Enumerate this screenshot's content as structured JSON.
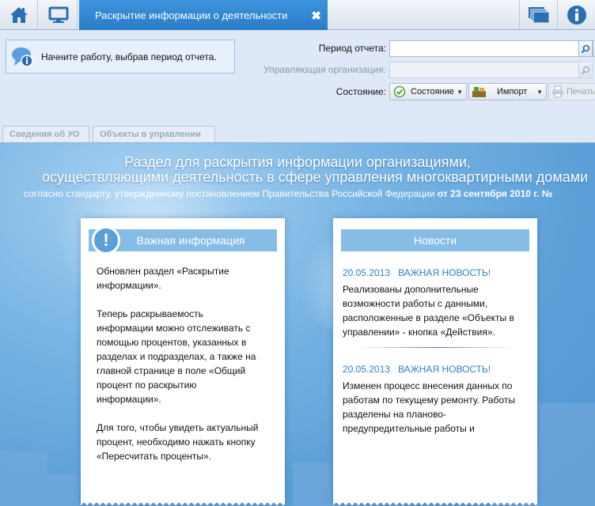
{
  "topbar": {
    "home_icon": "home-icon",
    "monitor_icon": "monitor-icon",
    "tab_title": "Раскрытие информации о деятельности",
    "tab_close": "✖",
    "windows_icon": "windows-icon",
    "info_icon": "info-icon"
  },
  "form": {
    "hint": "Начните работу, выбрав период отчета.",
    "period_label": "Период отчета:",
    "period_value": "",
    "org_label": "Управляющая организация:",
    "org_value": "",
    "state_label": "Состояние:",
    "state_button": "Состояние",
    "import_button": "Импорт",
    "print_button": "Печать"
  },
  "subtabs": [
    "Сведения об УО",
    "Объекты в управлении"
  ],
  "content": {
    "headline_line1": "Раздел для раскрытия информации организациями,",
    "headline_line2": "осуществляющими деятельность в сфере управления многоквартирными домами",
    "subline": "согласно стандарту, утвержденному постановлением Правительства Российской Федерации",
    "subline_date": "от 23 сентября 2010 г. №",
    "important": {
      "title": "Важная информация",
      "badge": "!",
      "p1": "Обновлен раздел «Раскрытие\nинформации».",
      "p2": "Теперь раскрываемость\nинформации можно отслеживать с\nпомощью процентов, указанных в\nразделах и подразделах, а также на\nглавной странице в поле «Общий\nпроцент по раскрытию\nинформации».",
      "p3": "Для того, чтобы увидеть актуальный\nпроцент, необходимо нажать кнопку\n«Пересчитать проценты»."
    },
    "news": {
      "title": "Новости",
      "items": [
        {
          "date": "20.05.2013",
          "headline": "ВАЖНАЯ НОВОСТЬ!",
          "text": "Реализованы дополнительные\nвозможности работы с данными,\nрасположенные в разделе «Объекты в\nуправлении» - кнопка «Действия»."
        },
        {
          "date": "20.05.2013",
          "headline": "ВАЖНАЯ НОВОСТЬ!",
          "text": "Изменен процесс внесения данных по\nработам по текущему ремонту. Работы\nразделены на планово-\nпредупредительные работы и"
        }
      ]
    }
  },
  "colors": {
    "tab_active": "#2a7cc7",
    "card_header": "#86bde5",
    "news_date": "#2e7fc7",
    "background": "#5b9fd8"
  }
}
